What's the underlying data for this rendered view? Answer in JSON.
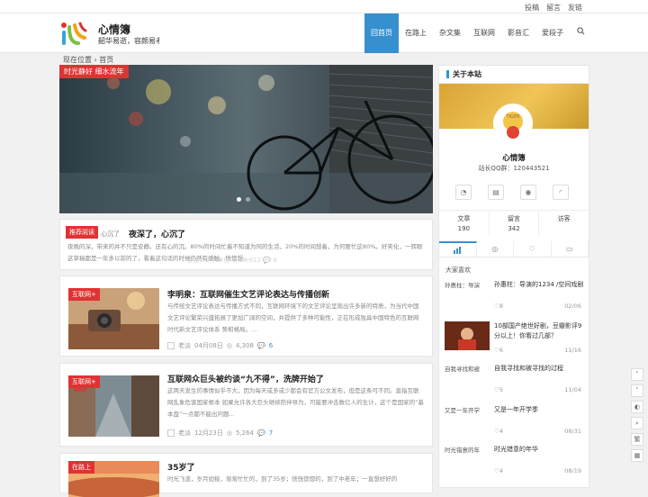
{
  "topbar": {
    "links": [
      "投稿",
      "留言",
      "友链"
    ]
  },
  "header": {
    "title": "心情簿",
    "subtitle": "韶华易逝，容颜易老"
  },
  "nav": {
    "items": [
      "回首页",
      "在路上",
      "杂文集",
      "互联网",
      "影音汇",
      "爱段子"
    ],
    "active": 0
  },
  "breadcrumb": {
    "text": "现在位置 › 首页"
  },
  "slider": {
    "tag": "时光静好 细水流年",
    "slides": 3,
    "current": 1
  },
  "featured": {
    "tag": "推荐阅读",
    "tag_trail": "心沉了",
    "title": "夜深了，心沉了",
    "excerpt": "夜晚的深，带来的并不只是安静。还有心的沉。80%的时间忙着不知道为何的生活，20%的时间想着，为何要忙这80%。好笑化，一转眼这草稿都是一年多以前的了，看着这句话的时候仍然有感触。恍惚想...",
    "meta_overlay": "老淡  01月02日  ◎ 18,612  💬 8"
  },
  "posts": [
    {
      "tag": "互联网+",
      "title": "李明泉：互联网催生文艺评论表达与传播创新",
      "excerpt": "与传统文艺评论表达与传播方式不同，互联网环境下的文艺评论呈现出许多新的特质，为当代中国文艺评论繁荣兴盛拓展了更加广阔的空间，并提供了多种可能性，正在形成独具中国特色的互联网时代新文艺评论体系 势和格局。...",
      "author": "老淡",
      "date": "04月08日",
      "views": "4,308",
      "comments": "6"
    },
    {
      "tag": "互联网+",
      "title": "互联网众巨头被约谈“九不得”，洗牌开始了",
      "excerpt": "这两天发生的事情似乎不大，因为每天或多或少都会有官方公文发布，但是这条可不同。直指互联网乱象危害国家根本 如果允许各大巨头继续陪伴导为，可能要冲击数亿人的生计，这个是国家的“基本盘”一点都不能出问题...",
      "author": "老淡",
      "date": "12月23日",
      "views": "5,264",
      "comments": "7"
    },
    {
      "tag": "在路上",
      "title": "35岁了",
      "excerpt": "时光飞逝，岁月如梭，匆匆忙忙的，到了35岁；恍恍惚惚的，到了中老年；一直想好好的"
    }
  ],
  "sidebar": {
    "heading": "关于本站",
    "name": "心情簿",
    "qq": "站长QQ群：120443521",
    "icons": [
      "wechat-icon",
      "book-icon",
      "weibo-icon",
      "rss-icon"
    ],
    "stats": [
      {
        "label": "文章",
        "value": "190"
      },
      {
        "label": "留言",
        "value": "342"
      },
      {
        "label": "访客",
        "value": ""
      }
    ],
    "tabs": [
      "热门",
      "浏览",
      "喜欢",
      "评论"
    ],
    "popular_heading": "大家喜欢",
    "popular": [
      {
        "thumb_alt": "孙惠柱：导演",
        "title": "孙惠柱：导演的1234 /空间戏剧",
        "likes": "8",
        "date": "02/06"
      },
      {
        "thumb_alt": "",
        "title": "10部国产绝世好剧，豆瓣影评9分以上！你看过几部？",
        "likes": "6",
        "date": "11/16"
      },
      {
        "thumb_alt": "自我寻找和被",
        "title": "自我寻找和被寻找的过程",
        "likes": "5",
        "date": "11/04"
      },
      {
        "thumb_alt": "又是一年开学",
        "title": "又是一年开学季",
        "likes": "4",
        "date": "08/31"
      },
      {
        "thumb_alt": "时光错意的年",
        "title": "时光错意的年华",
        "likes": "4",
        "date": "08/19"
      }
    ]
  },
  "float_buttons": [
    "up-icon",
    "down-icon",
    "theme-icon",
    "search-icon",
    "traditional-label",
    "qrcode-icon"
  ],
  "float_traditional": "繁"
}
